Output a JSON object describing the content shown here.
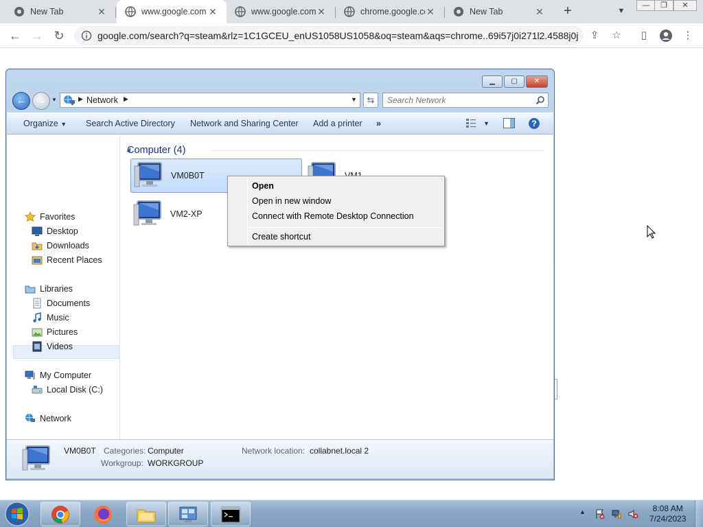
{
  "browser": {
    "tabs": [
      {
        "title": "New Tab",
        "active": false
      },
      {
        "title": "www.google.com",
        "active": true
      },
      {
        "title": "www.google.com",
        "active": false
      },
      {
        "title": "chrome.google.co",
        "active": false
      },
      {
        "title": "New Tab",
        "active": false
      }
    ],
    "url": "google.com/search?q=steam&rlz=1C1GCEU_enUS1058US1058&oq=steam&aqs=chrome..69i57j0i271l2.4588j0j..."
  },
  "explorer": {
    "address_crumb": "Network",
    "search_placeholder": "Search Network",
    "commands": {
      "organize": "Organize",
      "search_ad": "Search Active Directory",
      "sharing_center": "Network and Sharing Center",
      "add_printer": "Add a printer",
      "more": "»"
    },
    "nav": {
      "favorites": "Favorites",
      "desktop": "Desktop",
      "downloads": "Downloads",
      "recent_places": "Recent Places",
      "libraries": "Libraries",
      "documents": "Documents",
      "music": "Music",
      "pictures": "Pictures",
      "videos": "Videos",
      "my_computer": "My Computer",
      "local_disk": "Local Disk (C:)",
      "network": "Network"
    },
    "group_header": "Computer (4)",
    "computers": [
      "VM0B0T",
      "VM1",
      "VM2-XP"
    ],
    "context_menu": {
      "open": "Open",
      "open_new_window": "Open in new window",
      "connect_rdp": "Connect with Remote Desktop Connection",
      "create_shortcut": "Create shortcut"
    },
    "details": {
      "name": "VM0B0T",
      "categories_label": "Categories:",
      "categories_value": "Computer",
      "workgroup_label": "Workgroup:",
      "workgroup_value": "WORKGROUP",
      "location_label": "Network location:",
      "location_value": "collabnet.local  2"
    }
  },
  "taskbar": {
    "clock_time": "8:08 AM",
    "clock_date": "7/24/2023"
  }
}
